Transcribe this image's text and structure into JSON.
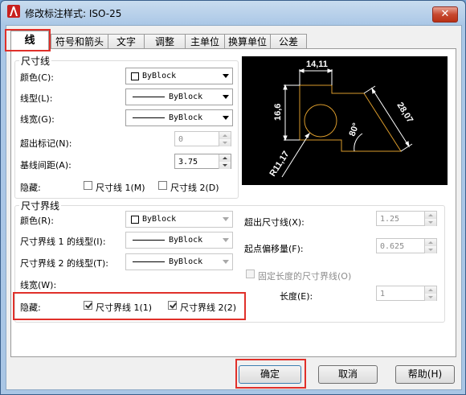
{
  "window": {
    "title": "修改标注样式: ISO-25",
    "close_label": "✕"
  },
  "tabs": [
    "线",
    "符号和箭头",
    "文字",
    "调整",
    "主单位",
    "换算单位",
    "公差"
  ],
  "dim_lines": {
    "group_label": "尺寸线",
    "color_label": "颜色(C):",
    "color_value": "ByBlock",
    "linetype_label": "线型(L):",
    "linetype_value": "ByBlock",
    "lineweight_label": "线宽(G):",
    "lineweight_value": "ByBlock",
    "extend_label": "超出标记(N):",
    "extend_value": "0",
    "baseline_label": "基线间距(A):",
    "baseline_value": "3.75",
    "suppress_label": "隐藏:",
    "suppress1_label": "尺寸线 1(M)",
    "suppress1_checked": false,
    "suppress2_label": "尺寸线 2(D)",
    "suppress2_checked": false
  },
  "ext_lines": {
    "group_label": "尺寸界线",
    "color_label": "颜色(R):",
    "color_value": "ByBlock",
    "linetype1_label": "尺寸界线 1 的线型(I):",
    "linetype1_value": "ByBlock",
    "linetype2_label": "尺寸界线 2 的线型(T):",
    "linetype2_value": "ByBlock",
    "lineweight_label": "线宽(W):",
    "suppress_label": "隐藏:",
    "suppress1_label": "尺寸界线 1(1)",
    "suppress1_checked": true,
    "suppress2_label": "尺寸界线 2(2)",
    "suppress2_checked": true,
    "extend_label": "超出尺寸线(X):",
    "extend_value": "1.25",
    "offset_label": "起点偏移量(F):",
    "offset_value": "0.625",
    "fixed_label": "固定长度的尺寸界线(O)",
    "fixed_checked": false,
    "length_label": "长度(E):",
    "length_value": "1"
  },
  "preview": {
    "dim_top": "14,11",
    "dim_left": "16,6",
    "dim_right": "28,07",
    "dim_angle": "80°",
    "dim_radius": "R11,17"
  },
  "buttons": {
    "ok": "确定",
    "cancel": "取消",
    "help": "帮助(H)"
  },
  "colors": {
    "highlight_box": "#e0302a",
    "preview_bg": "#000000",
    "preview_shape": "#d99a2b",
    "preview_dims": "#ffffff"
  }
}
